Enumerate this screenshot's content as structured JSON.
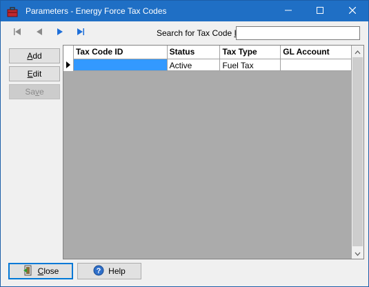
{
  "window": {
    "title": "Parameters - Energy Force Tax Codes",
    "controls": {
      "minimize": "minimize",
      "maximize": "maximize",
      "close": "close"
    }
  },
  "toolbar": {
    "search_label_pre": "Search for Tax Code ",
    "search_label_key": "ID",
    "search_value": ""
  },
  "sidebar": {
    "add": {
      "key": "A",
      "rest": "dd"
    },
    "edit": {
      "key": "E",
      "rest": "dit"
    },
    "save": {
      "pre": "Sa",
      "key": "v",
      "rest": "e",
      "enabled": false
    }
  },
  "grid": {
    "columns": [
      "Tax Code ID",
      "Status",
      "Tax Type",
      "GL Account"
    ],
    "rows": [
      {
        "tax_code_id": "",
        "status": "Active",
        "tax_type": "Fuel Tax",
        "gl_account": ""
      }
    ]
  },
  "footer": {
    "close": {
      "key": "C",
      "rest": "lose"
    },
    "help": "Help"
  },
  "colors": {
    "titlebar": "#1f6fc5",
    "selection": "#3399ff",
    "default_button_border": "#0078d7"
  },
  "icons": {
    "app": "toolbox-icon",
    "first": "first-record-icon",
    "prev": "previous-record-icon",
    "next": "next-record-icon",
    "last": "last-record-icon",
    "close_btn": "exit-door-icon",
    "help_btn": "help-question-icon"
  }
}
